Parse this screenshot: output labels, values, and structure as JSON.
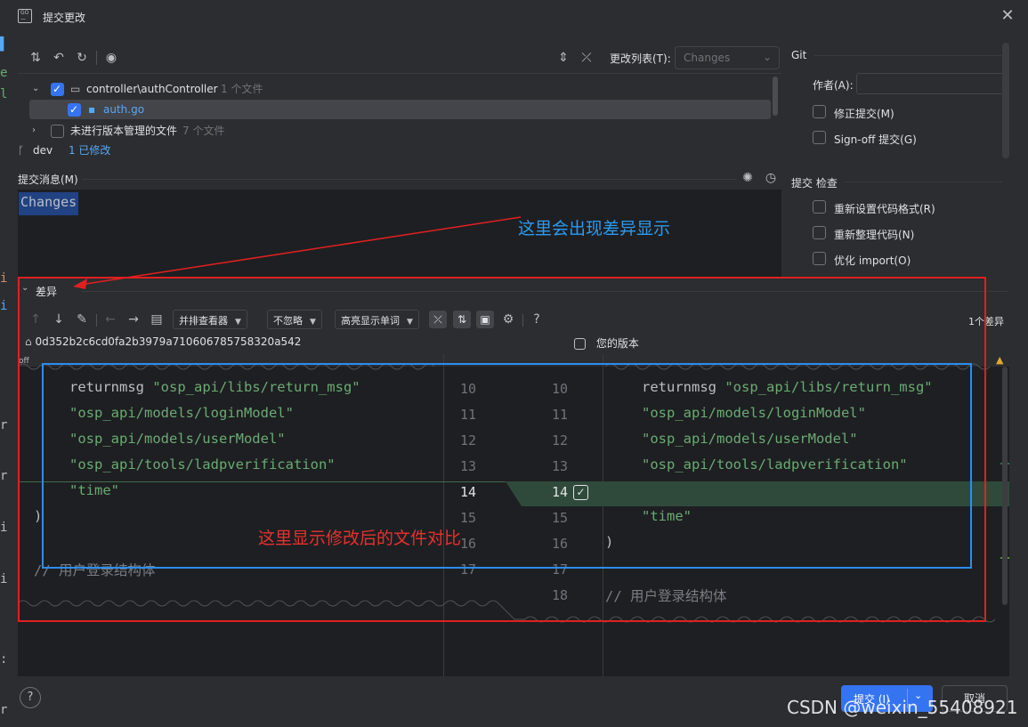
{
  "window": {
    "title": "提交更改"
  },
  "toolbar": {
    "changelist_label": "更改列表(T):",
    "changelist_value": "Changes"
  },
  "tree": {
    "folder": {
      "name": "controller\\authController",
      "count": "1 个文件"
    },
    "file": {
      "name": "auth.go"
    },
    "unversioned": {
      "name": "未进行版本管理的文件",
      "count": "7 个文件"
    }
  },
  "branch": {
    "name": "dev",
    "status": "1 已修改"
  },
  "commit_message": {
    "label": "提交消息(M)",
    "value": "Changes"
  },
  "git_panel": {
    "title": "Git",
    "author_label": "作者(A):",
    "amend_label": "修正提交(M)",
    "signoff_label": "Sign-off 提交(G)",
    "checks_title": "提交 检查",
    "reformat_label": "重新设置代码格式(R)",
    "rearrange_label": "重新整理代码(N)",
    "optimize_label": "优化 import(O)"
  },
  "diff": {
    "section_label": "差异",
    "viewer_mode": "并排查看器",
    "ignore_mode": "不忽略",
    "highlight_mode": "高亮显示单词",
    "diff_count": "1个差异",
    "left_hash": "0d352b2c6cd0fa2b3979a710606785758320a542",
    "right_label": "您的版本",
    "off_label": "off",
    "left_lines": [
      {
        "num": "10",
        "pre": "returnmsg ",
        "str": "\"osp_api/libs/return_msg\""
      },
      {
        "num": "11",
        "pre": "",
        "str": "\"osp_api/models/loginModel\""
      },
      {
        "num": "12",
        "pre": "",
        "str": "\"osp_api/models/userModel\""
      },
      {
        "num": "13",
        "pre": "",
        "str": "\"osp_api/tools/ladpverification\""
      },
      {
        "num": "14",
        "pre": "",
        "str": "\"time\""
      },
      {
        "num": "15",
        "pre": ")",
        "str": ""
      },
      {
        "num": "16",
        "pre": "",
        "str": ""
      },
      {
        "num": "17",
        "pre": "// 用户登录结构体",
        "str": ""
      }
    ],
    "right_lines": [
      {
        "num": "10",
        "pre": "returnmsg ",
        "str": "\"osp_api/libs/return_msg\""
      },
      {
        "num": "11",
        "pre": "",
        "str": "\"osp_api/models/loginModel\""
      },
      {
        "num": "12",
        "pre": "",
        "str": "\"osp_api/models/userModel\""
      },
      {
        "num": "13",
        "pre": "",
        "str": "\"osp_api/tools/ladpverification\""
      },
      {
        "num": "14",
        "pre": "",
        "str": ""
      },
      {
        "num": "15",
        "pre": "",
        "str": "\"time\""
      },
      {
        "num": "16",
        "pre": ")",
        "str": ""
      },
      {
        "num": "17",
        "pre": "",
        "str": ""
      },
      {
        "num": "18",
        "pre": "// 用户登录结构体",
        "str": ""
      }
    ]
  },
  "annotations": {
    "blue_note": "这里会出现差异显示",
    "red_note": "这里显示修改后的文件对比"
  },
  "buttons": {
    "commit": "提交 (I)",
    "cancel": "取消",
    "help": "?"
  },
  "watermark": "CSDN @weixin_55408921"
}
